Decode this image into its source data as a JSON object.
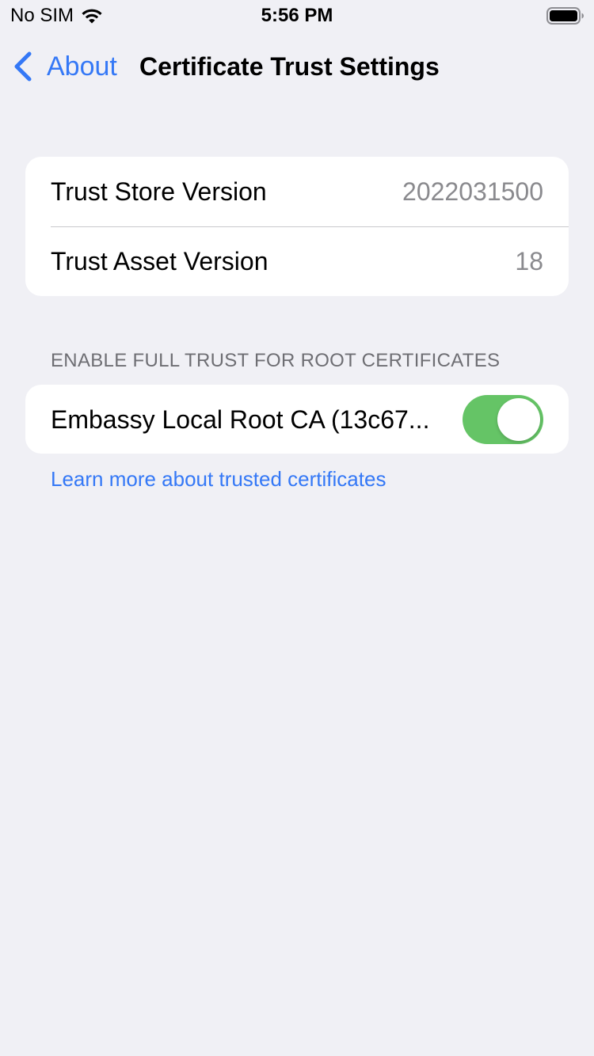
{
  "status_bar": {
    "carrier": "No SIM",
    "time": "5:56 PM",
    "wifi_icon": "wifi-icon",
    "battery_icon": "battery-icon"
  },
  "nav": {
    "back_label": "About",
    "back_icon": "chevron-left-icon",
    "title": "Certificate Trust Settings"
  },
  "versions": {
    "rows": [
      {
        "label": "Trust Store Version",
        "value": "2022031500"
      },
      {
        "label": "Trust Asset Version",
        "value": "18"
      }
    ]
  },
  "trust_section": {
    "header": "ENABLE FULL TRUST FOR ROOT CERTIFICATES",
    "certificates": [
      {
        "label": "Embassy Local Root CA (13c67...",
        "enabled": true
      }
    ],
    "learn_more": "Learn more about trusted certificates"
  },
  "colors": {
    "accent": "#3478f6",
    "toggle_on": "#65c466",
    "background": "#f0f0f5",
    "secondary_text": "#8a8a8e"
  }
}
